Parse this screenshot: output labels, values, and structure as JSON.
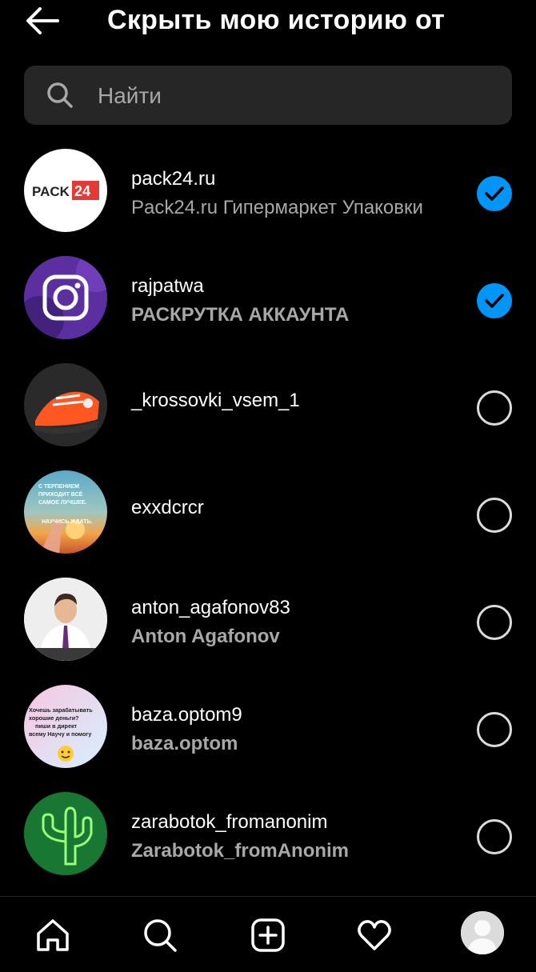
{
  "header": {
    "back_icon": "arrow-left-icon",
    "title": "Скрыть мою историю от"
  },
  "search": {
    "icon": "search-icon",
    "placeholder": "Найти"
  },
  "users": [
    {
      "username": "pack24.ru",
      "full_name": "Pack24.ru Гипермаркет Упаковки",
      "selected": true,
      "avatar_text": "PACK24"
    },
    {
      "username": "rajpatwa",
      "full_name": "РАСКРУТКА АККАУНТА",
      "selected": true
    },
    {
      "username": "_krossovki_vsem_1",
      "full_name": "",
      "selected": false
    },
    {
      "username": "exxdcrcr",
      "full_name": "",
      "selected": false,
      "avatar_text": [
        "С ТЕРПЕНИЕМ",
        "ПРИХОДИТ ВСЁ",
        "САМОЕ ЛУЧШЕЕ.",
        "НАУЧИСЬ ЖДАТЬ."
      ]
    },
    {
      "username": "anton_agafonov83",
      "full_name": "Anton  Agafonov",
      "selected": false
    },
    {
      "username": "baza.optom9",
      "full_name": "baza.optom",
      "selected": false,
      "avatar_text": [
        "Хочешь зарабатывать",
        "хорошие деньги?",
        "пиши в директ",
        "всему Научу и помогу"
      ]
    },
    {
      "username": "zarabotok_fromanonim",
      "full_name": "Zarabotok_fromAnonim",
      "selected": false
    }
  ],
  "colors": {
    "background": "#000000",
    "accent": "#0095f6",
    "secondary_text": "#a8a8a8",
    "search_bg": "#262626"
  },
  "bottom_nav": [
    {
      "icon": "home-icon"
    },
    {
      "icon": "search-icon"
    },
    {
      "icon": "add-post-icon"
    },
    {
      "icon": "heart-icon"
    },
    {
      "icon": "profile-avatar"
    }
  ]
}
